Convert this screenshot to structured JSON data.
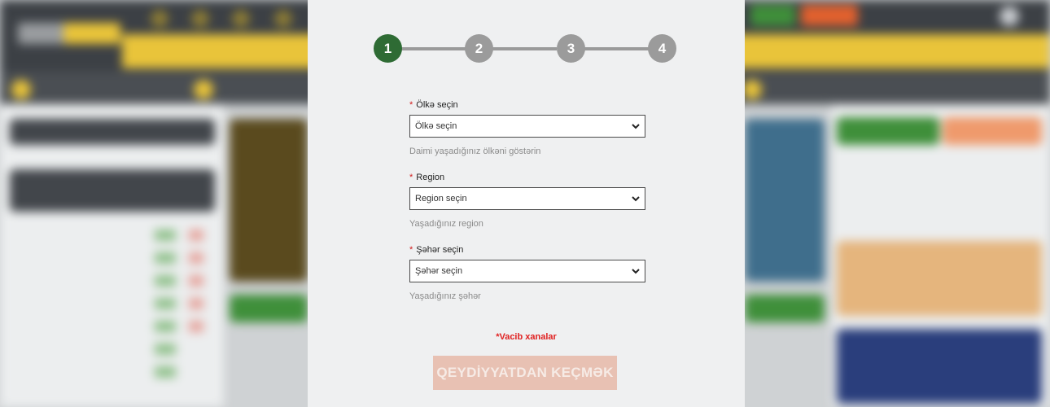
{
  "stepper": {
    "steps": [
      "1",
      "2",
      "3",
      "4"
    ],
    "active_step": 1
  },
  "form": {
    "country": {
      "label": "Ölkə seçin",
      "value": "Ölkə seçin",
      "hint": "Daimi yaşadığınız ölkəni göstərin"
    },
    "region": {
      "label": "Region",
      "value": "Region seçin",
      "hint": "Yaşadığınız region"
    },
    "city": {
      "label": "Şəhər seçin",
      "value": "Şəhər seçin",
      "hint": "Yaşadığınız şəhər"
    },
    "required_marker": "*",
    "required_note": "*Vacib xanalar",
    "submit_label": "QEYDİYYATDAN KEÇMƏK"
  },
  "colors": {
    "active_step": "#2e6b34",
    "inactive_step": "#9b9b9b",
    "required": "#e02020",
    "submit_bg": "#e8c1b3"
  },
  "icons": {
    "select_arrow": "chevron-down-icon"
  }
}
